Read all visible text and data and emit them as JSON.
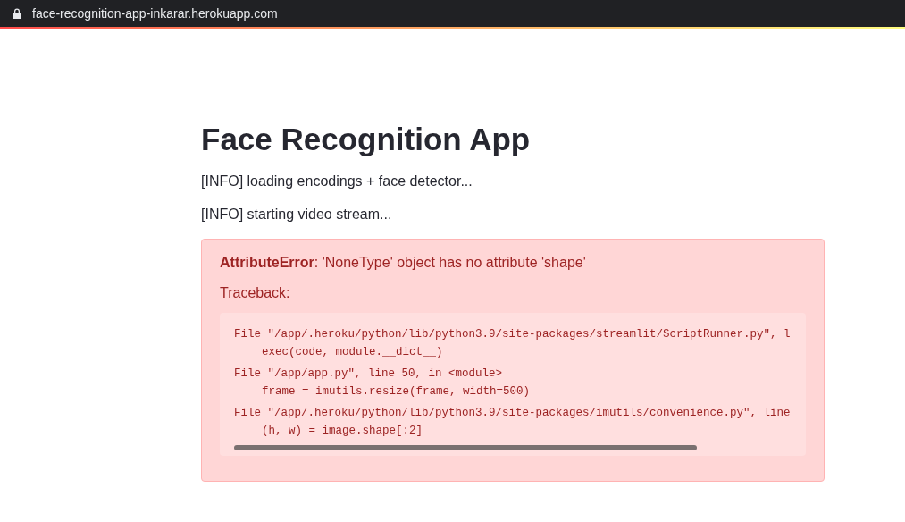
{
  "address_bar": {
    "url": "face-recognition-app-inkarar.herokuapp.com"
  },
  "title": "Face Recognition App",
  "messages": [
    "[INFO] loading encodings + face detector...",
    "[INFO] starting video stream..."
  ],
  "error": {
    "type": "AttributeError",
    "message": ": 'NoneType' object has no attribute 'shape'",
    "traceback_label": "Traceback:",
    "frames": [
      {
        "location": "File \"/app/.heroku/python/lib/python3.9/site-packages/streamlit/ScriptRunner.py\", l",
        "code": "exec(code, module.__dict__)"
      },
      {
        "location": "File \"/app/app.py\", line 50, in <module>",
        "code": "frame = imutils.resize(frame, width=500)"
      },
      {
        "location": "File \"/app/.heroku/python/lib/python3.9/site-packages/imutils/convenience.py\", line",
        "code": "(h, w) = image.shape[:2]"
      }
    ]
  }
}
